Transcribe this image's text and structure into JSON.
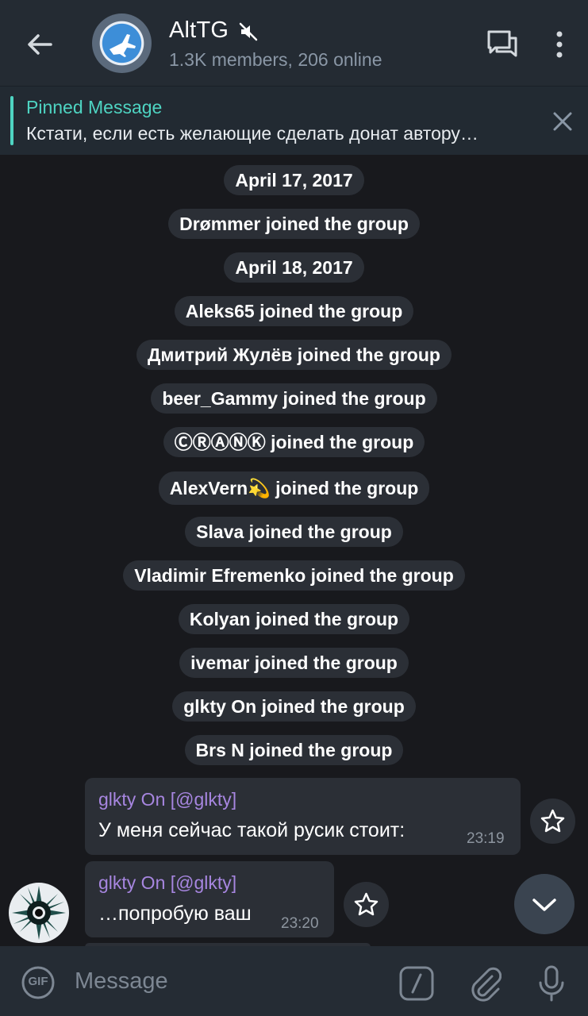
{
  "header": {
    "title": "AltTG",
    "subtitle": "1.3K members, 206 online"
  },
  "pinned": {
    "title": "Pinned Message",
    "text": "Кстати, если есть желающие сделать донат автору…"
  },
  "service_messages": [
    "April 17, 2017",
    "Drømmer joined the group",
    "April 18, 2017",
    "Aleks65 joined the group",
    "Дмитрий Жулёв joined the group",
    "beer_Gammy joined the group",
    "ⒸⓇⒶⓃⓀ joined the group",
    "AlexVern💫 joined the group",
    "Slava joined the group",
    "Vladimir Efremenko joined the group",
    "Kolyan joined the group",
    "ivemar joined the group",
    "glkty On joined the group",
    "Brs N joined the group"
  ],
  "messages": [
    {
      "sender": "glkty On [@glkty]",
      "text": "У меня сейчас такой русик стоит:",
      "time": "23:19"
    },
    {
      "sender": "glkty On [@glkty]",
      "text": "…попробую ваш",
      "time": "23:20"
    }
  ],
  "input": {
    "placeholder": "Message",
    "gif_label": "GIF"
  },
  "colors": {
    "accent": "#4ed4c2",
    "sender_name": "#a786e0",
    "header_bg": "#242b33",
    "chat_bg": "#18191d",
    "bubble_bg": "#2b2f36"
  }
}
